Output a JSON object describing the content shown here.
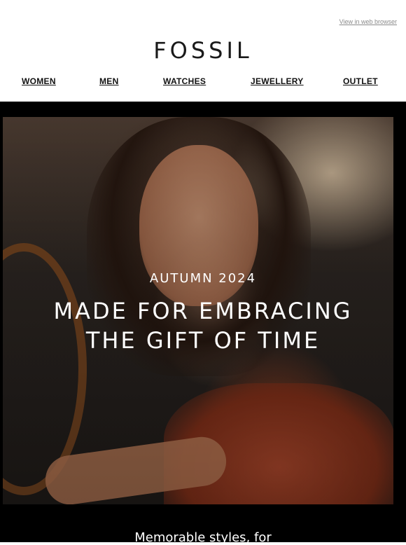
{
  "header": {
    "view_in_browser": "View in web browser",
    "logo_text": "FOSSIL"
  },
  "nav": {
    "items": [
      {
        "label": "WOMEN"
      },
      {
        "label": "MEN"
      },
      {
        "label": "WATCHES"
      },
      {
        "label": "JEWELLERY"
      },
      {
        "label": "OUTLET"
      }
    ]
  },
  "hero": {
    "eyebrow": "AUTUMN 2024",
    "headline_line1": "MADE FOR EMBRACING",
    "headline_line2": "THE GIFT OF TIME",
    "subtext": "Memorable styles, for"
  },
  "colors": {
    "hero_background": "#000000",
    "text_on_hero": "#ffffff",
    "nav_text": "#111111"
  }
}
